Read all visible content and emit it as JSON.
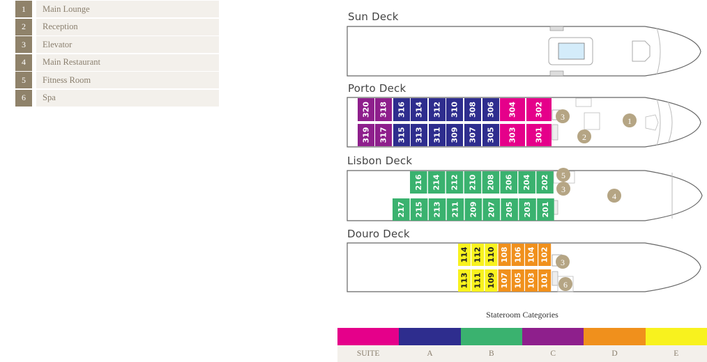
{
  "legend": [
    {
      "num": "1",
      "label": "Main Lounge"
    },
    {
      "num": "2",
      "label": "Reception"
    },
    {
      "num": "3",
      "label": "Elevator"
    },
    {
      "num": "4",
      "label": "Main Restaurant"
    },
    {
      "num": "5",
      "label": "Fitness Room"
    },
    {
      "num": "6",
      "label": "Spa"
    }
  ],
  "colors": {
    "SUITE": "#e5008a",
    "A": "#2e2d8e",
    "B": "#3ab26f",
    "C": "#8e1f8c",
    "D": "#f0901c",
    "E": "#f8f21e",
    "poi": "#b5a584"
  },
  "decks": {
    "sun": {
      "title": "Sun Deck"
    },
    "porto": {
      "title": "Porto Deck",
      "top_row": [
        {
          "num": "320",
          "cat": "C"
        },
        {
          "num": "318",
          "cat": "C"
        },
        {
          "num": "316",
          "cat": "A"
        },
        {
          "num": "314",
          "cat": "A"
        },
        {
          "num": "312",
          "cat": "A"
        },
        {
          "num": "310",
          "cat": "A"
        },
        {
          "num": "308",
          "cat": "A"
        },
        {
          "num": "306",
          "cat": "A"
        },
        {
          "num": "304",
          "cat": "SUITE"
        },
        {
          "num": "302",
          "cat": "SUITE"
        }
      ],
      "bottom_row": [
        {
          "num": "319",
          "cat": "C"
        },
        {
          "num": "317",
          "cat": "C"
        },
        {
          "num": "315",
          "cat": "A"
        },
        {
          "num": "313",
          "cat": "A"
        },
        {
          "num": "311",
          "cat": "A"
        },
        {
          "num": "309",
          "cat": "A"
        },
        {
          "num": "307",
          "cat": "A"
        },
        {
          "num": "305",
          "cat": "A"
        },
        {
          "num": "303",
          "cat": "SUITE"
        },
        {
          "num": "301",
          "cat": "SUITE"
        }
      ],
      "markers": [
        "3",
        "2",
        "1"
      ]
    },
    "lisbon": {
      "title": "Lisbon Deck",
      "top_row": [
        {
          "num": "216",
          "cat": "B"
        },
        {
          "num": "214",
          "cat": "B"
        },
        {
          "num": "212",
          "cat": "B"
        },
        {
          "num": "210",
          "cat": "B"
        },
        {
          "num": "208",
          "cat": "B"
        },
        {
          "num": "206",
          "cat": "B"
        },
        {
          "num": "204",
          "cat": "B"
        },
        {
          "num": "202",
          "cat": "B"
        }
      ],
      "bottom_row": [
        {
          "num": "217",
          "cat": "B"
        },
        {
          "num": "215",
          "cat": "B"
        },
        {
          "num": "213",
          "cat": "B"
        },
        {
          "num": "211",
          "cat": "B"
        },
        {
          "num": "209",
          "cat": "B"
        },
        {
          "num": "207",
          "cat": "B"
        },
        {
          "num": "205",
          "cat": "B"
        },
        {
          "num": "203",
          "cat": "B"
        },
        {
          "num": "201",
          "cat": "B"
        }
      ],
      "markers": [
        "5",
        "3",
        "4"
      ]
    },
    "douro": {
      "title": "Douro Deck",
      "top_row": [
        {
          "num": "114",
          "cat": "E"
        },
        {
          "num": "112",
          "cat": "E"
        },
        {
          "num": "110",
          "cat": "E"
        },
        {
          "num": "108",
          "cat": "D"
        },
        {
          "num": "106",
          "cat": "D"
        },
        {
          "num": "104",
          "cat": "D"
        },
        {
          "num": "102",
          "cat": "D"
        }
      ],
      "bottom_row": [
        {
          "num": "113",
          "cat": "E"
        },
        {
          "num": "111",
          "cat": "E"
        },
        {
          "num": "109",
          "cat": "E"
        },
        {
          "num": "107",
          "cat": "D"
        },
        {
          "num": "105",
          "cat": "D"
        },
        {
          "num": "103",
          "cat": "D"
        },
        {
          "num": "101",
          "cat": "D"
        }
      ],
      "markers": [
        "3",
        "6"
      ]
    }
  },
  "categories": {
    "title": "Stateroom Categories",
    "items": [
      {
        "label": "SUITE",
        "color": "#e5008a"
      },
      {
        "label": "A",
        "color": "#2e2d8e"
      },
      {
        "label": "B",
        "color": "#3ab26f"
      },
      {
        "label": "C",
        "color": "#8e1f8c"
      },
      {
        "label": "D",
        "color": "#f0901c"
      },
      {
        "label": "E",
        "color": "#f8f21e"
      }
    ]
  }
}
